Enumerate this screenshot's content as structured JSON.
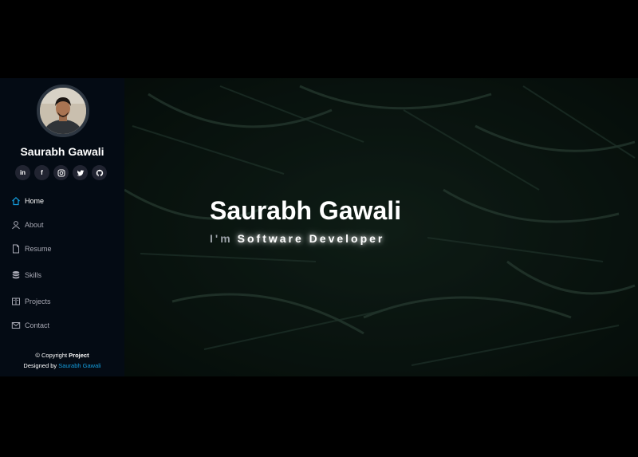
{
  "sidebar": {
    "name": "Saurabh Gawali",
    "socials": [
      {
        "label": "in",
        "icon": "linkedin-icon"
      },
      {
        "label": "f",
        "icon": "facebook-icon"
      },
      {
        "label": "instagram",
        "icon": "instagram-icon"
      },
      {
        "label": "twitter",
        "icon": "twitter-icon"
      },
      {
        "label": "github",
        "icon": "github-icon"
      }
    ],
    "nav": [
      {
        "label": "Home",
        "icon": "home-icon",
        "active": true
      },
      {
        "label": "About",
        "icon": "user-icon"
      },
      {
        "label": "Resume",
        "icon": "file-icon"
      },
      {
        "label": "Skills",
        "icon": "database-icon"
      },
      {
        "label": "Projects",
        "icon": "book-icon"
      },
      {
        "label": "Contact",
        "icon": "envelope-icon"
      }
    ],
    "footer": {
      "copyright_prefix": "© Copyright ",
      "copyright_name": "Project",
      "designed_prefix": "Designed by ",
      "designed_name": "Saurabh Gawali"
    }
  },
  "hero": {
    "title": "Saurabh Gawali",
    "subtitle_prefix": "I'm",
    "subtitle_role": "Software Developer"
  },
  "colors": {
    "sidebar_bg": "#040b14",
    "accent": "#149ddd",
    "nav_text": "#a8a9b4",
    "social_bg": "#212431"
  }
}
